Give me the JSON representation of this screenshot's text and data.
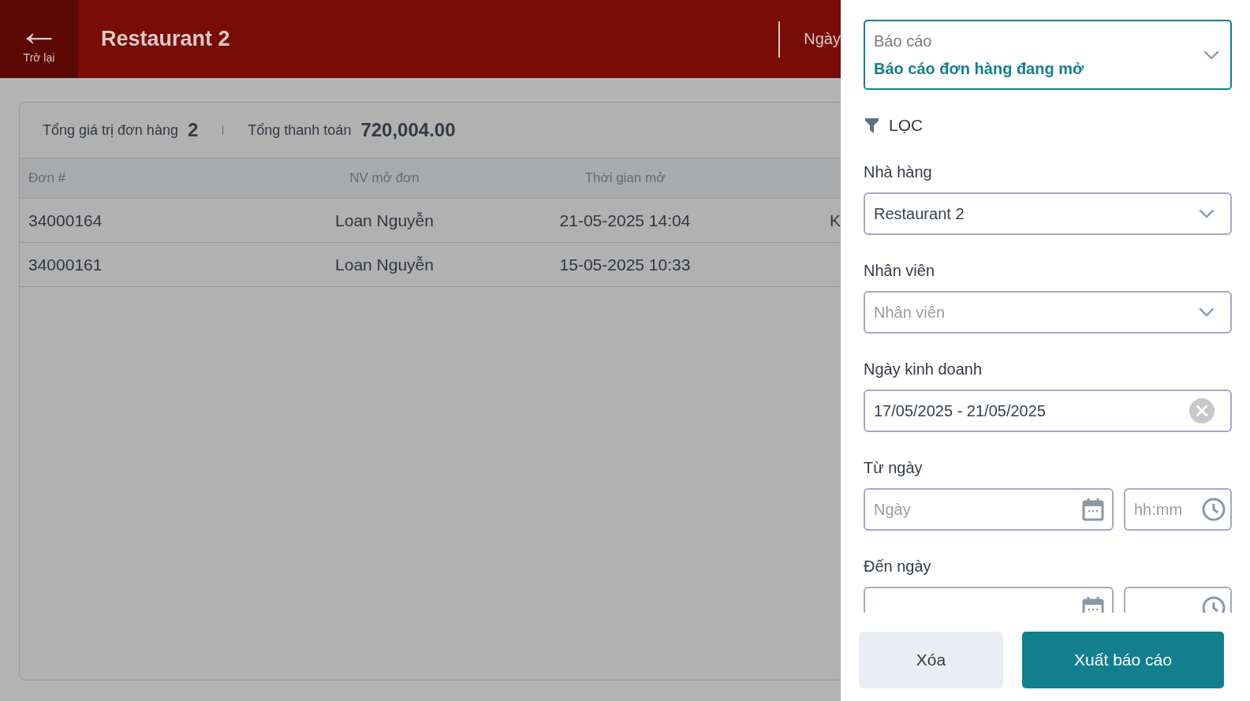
{
  "header": {
    "back_label": "Trở lại",
    "back_icon": "←",
    "title": "Restaurant 2",
    "date_label": "Ngày"
  },
  "summary": [
    {
      "label": "Tổng giá trị đơn hàng",
      "value": "2"
    },
    {
      "label": "Tổng thanh toán",
      "value": "720,004.00"
    }
  ],
  "table": {
    "columns": [
      "Đơn #",
      "NV mở đơn",
      "Thời gian mở"
    ],
    "rows": [
      {
        "cells": [
          "34000164",
          "Loan Nguyễn",
          "21-05-2025 14:04",
          "K"
        ]
      },
      {
        "cells": [
          "34000161",
          "Loan Nguyễn",
          "15-05-2025 10:33"
        ]
      }
    ]
  },
  "panel": {
    "report": {
      "label": "Báo cáo",
      "value": "Báo cáo đơn hàng đang mở"
    },
    "filter_title": "LỌC",
    "fields": [
      {
        "kind": "select",
        "label": "Nhà hàng",
        "value": "Restaurant 2"
      },
      {
        "kind": "select",
        "label": "Nhân viên",
        "placeholder": "Nhân viên"
      },
      {
        "kind": "range",
        "label": "Ngày kinh doanh",
        "value": "17/05/2025 - 21/05/2025"
      },
      {
        "kind": "datetime",
        "label": "Từ ngày",
        "date_placeholder": "Ngày",
        "time_placeholder": "hh:mm"
      },
      {
        "kind": "datetime",
        "label": "Đến ngày"
      }
    ],
    "buttons": [
      {
        "kind": "secondary",
        "label": "Xóa"
      },
      {
        "kind": "primary",
        "label": "Xuất báo cáo"
      }
    ]
  }
}
